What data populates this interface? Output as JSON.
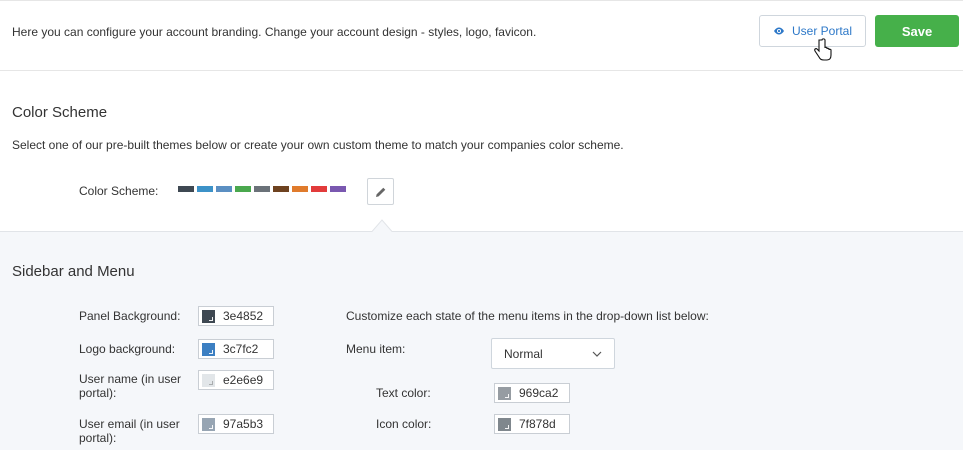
{
  "header": {
    "intro": "Here you can configure your account branding. Change your account design - styles, logo, favicon.",
    "user_portal_label": "User Portal",
    "save_label": "Save"
  },
  "color_scheme": {
    "title": "Color Scheme",
    "description": "Select one of our pre-built themes below or create your own custom theme to match your companies color scheme.",
    "label": "Color Scheme:",
    "swatches": [
      "#3e4852",
      "#3c92c8",
      "#5b8fc2",
      "#4aa84e",
      "#6b7279",
      "#6e4220",
      "#e07b2c",
      "#e23b3b",
      "#7a58b0"
    ]
  },
  "sidebar_menu": {
    "title": "Sidebar and Menu",
    "fields": [
      {
        "label": "Panel Background:",
        "value": "3e4852",
        "color": "#3e4852"
      },
      {
        "label": "Logo background:",
        "value": "3c7fc2",
        "color": "#3c7fc2"
      },
      {
        "label": "User name (in user portal):",
        "value": "e2e6e9",
        "color": "#e2e6e9"
      },
      {
        "label": "User email (in user portal):",
        "value": "97a5b3",
        "color": "#97a5b3"
      }
    ],
    "menu_instructions": "Customize each state of the menu items in the drop-down list below:",
    "menu_item_label": "Menu item:",
    "menu_item_value": "Normal",
    "text_color_label": "Text color:",
    "text_color_value": "969ca2",
    "text_color": "#969ca2",
    "icon_color_label": "Icon color:",
    "icon_color_value": "7f878d",
    "icon_color": "#7f878d"
  },
  "colors": {
    "accent": "#2d78c8",
    "save": "#46b04a"
  }
}
